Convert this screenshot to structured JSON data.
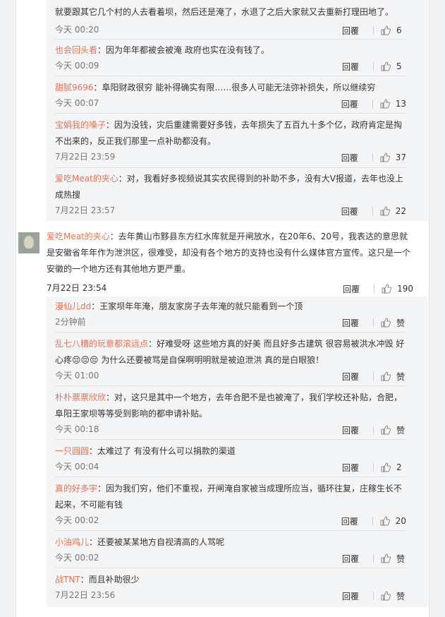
{
  "reply_label": "回覆",
  "top_replies": [
    {
      "name": "",
      "text": "就要跟其它几个村的人去看着坝，然后还是淹了，水退了之后大家就又去重新打理田地了。",
      "time": "今天 00:20",
      "likes": "6"
    },
    {
      "name": "也会回头看",
      "text": "：因为年年都被会被淹 政府也实在没有钱了。",
      "time": "今天 00:09",
      "likes": "5"
    },
    {
      "name": "甜腻9696",
      "text": "：阜阳财政很穷 能补得确实有限……很多人可能无法弥补损失，所以继续穷",
      "time": "今天 00:07",
      "likes": "13"
    },
    {
      "name": "宝娟我的嗓子",
      "text": "：因为没钱，灾后重建需要好多钱，去年损失了五百九十多个亿，政府肯定是掏不出来的，反正我们那里一点补助都没有。",
      "time": "7月22日 23:59",
      "likes": "37"
    },
    {
      "name": "爱吃Meat的夹心",
      "text": "：对，我看好多视频说其实农民得到的补助不多，没有大V报道，去年也没上成热搜",
      "time": "7月22日 23:57",
      "likes": "22"
    }
  ],
  "main_comment": {
    "name": "爱吃Meat的夹心",
    "text": "：去年黄山市黟县东方红水库就是开闸放水，在20年6、20号，我表达的意思就是安徽省年年作为泄洪区，很难受，却没有各个地方的支持也没有什么媒体官方宣传。这只是一个安徽的一个地方还有其他地方更严重。",
    "time": "7月22日 23:54",
    "likes": "190"
  },
  "sub_replies": [
    {
      "name": "漫仙儿dd",
      "text": "：王家坝年年淹，朋友家房子去年淹的就只能看到一个顶",
      "time": "2分钟前",
      "likes": "赞"
    },
    {
      "name": "乱七八糟的玩意都滚远点",
      "text": "：好难受呀 这些地方真的好美 而且好多古建筑 很容易被洪水冲毁 好心疼😔😔😔 为什么还要被骂是自保啊明明就是被迫泄洪 真的是白眼狼！",
      "time": "今天 01:00",
      "likes": "赞"
    },
    {
      "name": "朴朴票票欣欣",
      "text": "：对，这只是其中一个地方，去年合肥不是也被淹了，我们学校还补贴，合肥，阜阳王家坝等等受到影响的都申请补贴。",
      "time": "今天 00:18",
      "likes": "赞"
    },
    {
      "name": "一只圆圆",
      "text": "：太难过了 有没有什么可以捐款的渠道",
      "time": "今天 00:04",
      "likes": "2"
    },
    {
      "name": "真的好多宇",
      "text": "：因为我们穷，他们不重视，开闸淹自家被当成理所应当，循环往复，庄稼生长不起来，不可能有钱",
      "time": "今天 00:02",
      "likes": "20"
    },
    {
      "name": "小油鸡儿",
      "text": "：还要被某某地方自视清高的人骂呢",
      "time": "今天 00:02",
      "likes": "赞"
    },
    {
      "name": "战TNT",
      "text": "：而且补助很少",
      "time": "7月22日 23:56",
      "likes": "赞"
    }
  ]
}
